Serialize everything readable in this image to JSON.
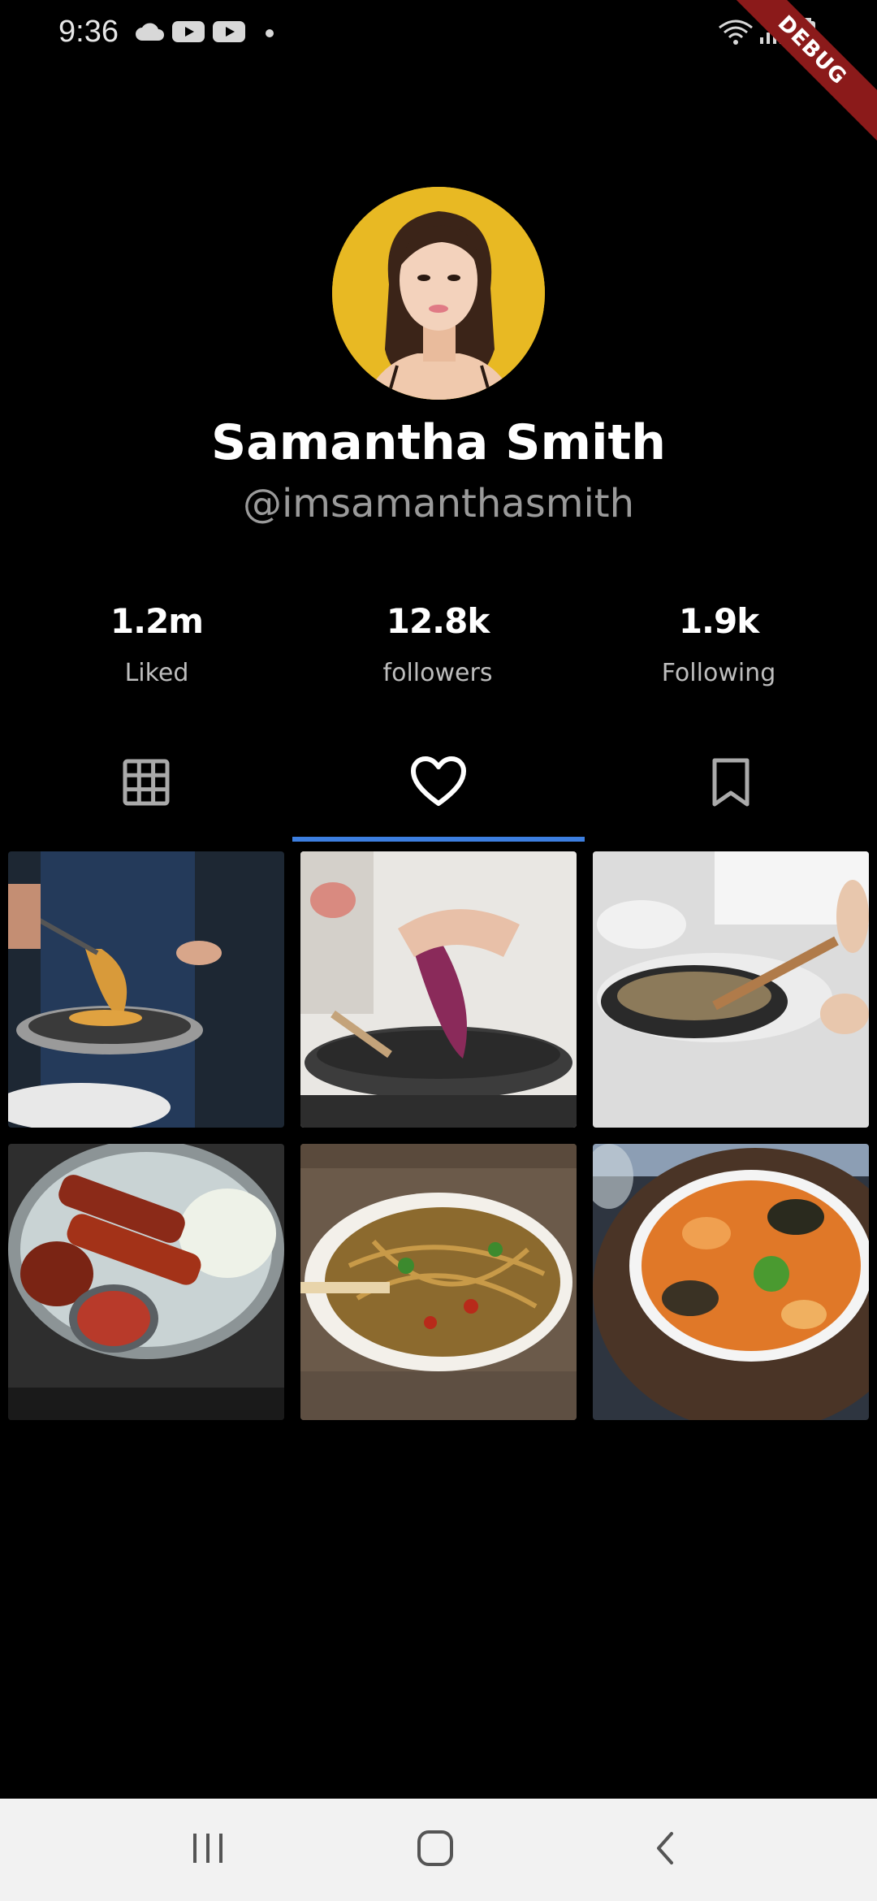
{
  "status_bar": {
    "time": "9:36",
    "icons": [
      "cloud-icon",
      "youtube-icon",
      "youtube-icon",
      "dot-icon",
      "wifi-icon",
      "signal-icon",
      "battery-icon"
    ],
    "debug_label": "DEBUG"
  },
  "profile": {
    "name": "Samantha Smith",
    "handle": "@imsamanthasmith",
    "avatar_bg": "#e8b923"
  },
  "stats": [
    {
      "value": "1.2m",
      "label": "Liked"
    },
    {
      "value": "12.8k",
      "label": "followers"
    },
    {
      "value": "1.9k",
      "label": "Following"
    }
  ],
  "tabs": [
    {
      "icon": "grid-icon",
      "selected": false
    },
    {
      "icon": "heart-icon",
      "selected": true
    },
    {
      "icon": "bookmark-icon",
      "selected": false
    }
  ],
  "accent_color": "#3d7fe0",
  "posts": [
    {
      "subject": "tossing pasta in pan"
    },
    {
      "subject": "stir-frying cabbage in wok"
    },
    {
      "subject": "cooking rice in frying pan"
    },
    {
      "subject": "grilled skewers with rice"
    },
    {
      "subject": "noodles with vegetables"
    },
    {
      "subject": "seafood soup with mussels"
    }
  ],
  "nav_bar": {
    "buttons": [
      "recent-apps-icon",
      "home-icon",
      "back-icon"
    ]
  }
}
